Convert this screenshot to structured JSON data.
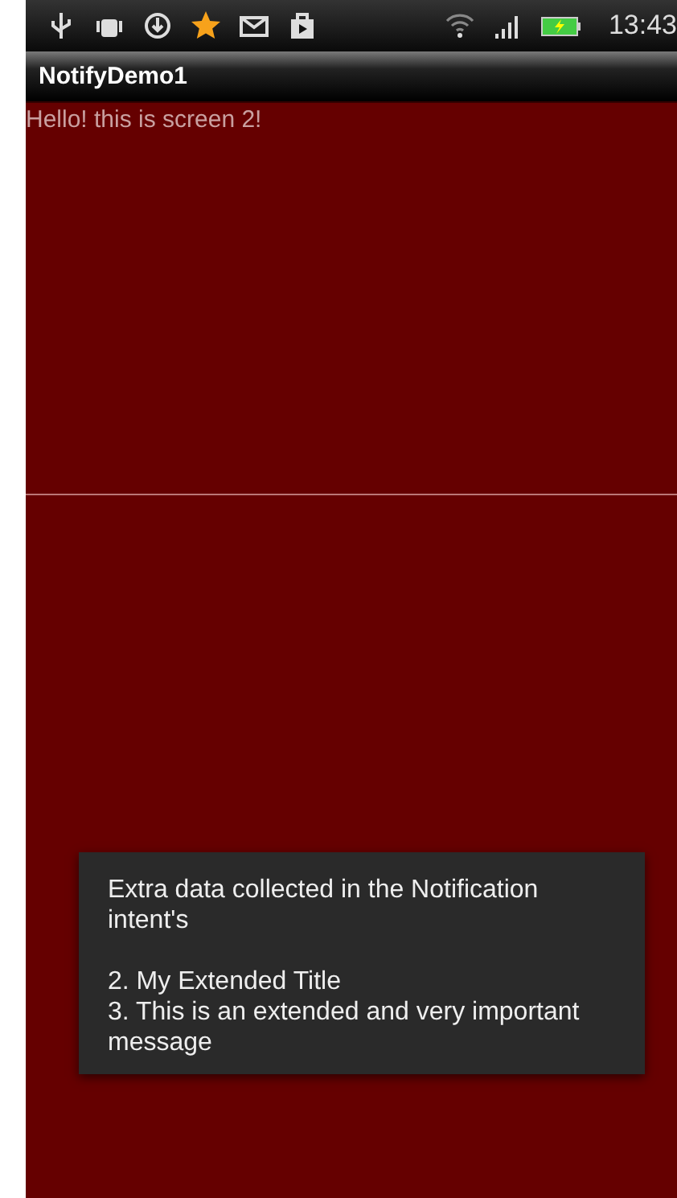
{
  "status_bar": {
    "time": "13:43"
  },
  "app_bar": {
    "title": "NotifyDemo1"
  },
  "content": {
    "text": "Hello! this is screen 2!"
  },
  "toast": {
    "lines": [
      "Extra data collected in the Notification intent's",
      "2. My Extended Title",
      "3. This is an extended and very important message"
    ]
  }
}
